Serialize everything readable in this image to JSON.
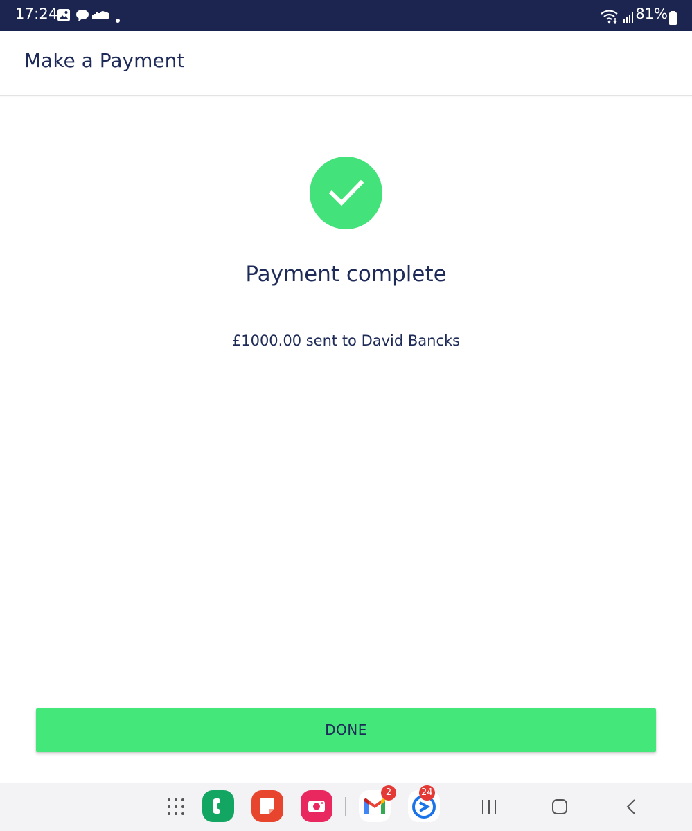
{
  "status_bar": {
    "time": "17:24",
    "battery_percent": "81%",
    "notification_icons": [
      "gallery-icon",
      "chat-bubble-icon",
      "soundcloud-icon",
      "dot-icon"
    ],
    "system_icons": [
      "wifi-icon",
      "signal-icon",
      "battery-icon"
    ]
  },
  "app_bar": {
    "title": "Make a Payment"
  },
  "result": {
    "icon": "checkmark-icon",
    "title": "Payment complete",
    "message": "£1000.00 sent to David Bancks"
  },
  "actions": {
    "done_label": "DONE"
  },
  "nav_bar": {
    "apps": [
      {
        "name": "app-drawer-icon"
      },
      {
        "name": "phone-app-icon"
      },
      {
        "name": "notes-app-icon"
      },
      {
        "name": "camera-app-icon"
      },
      {
        "name": "gmail-app-icon",
        "badge": "2"
      },
      {
        "name": "outlook-app-icon",
        "badge": "24"
      }
    ],
    "buttons": [
      "recents-button",
      "home-button",
      "back-button"
    ]
  },
  "colors": {
    "status_bar": "#1b2550",
    "text_primary": "#1e2b58",
    "accent_green": "#44e27a",
    "badge_red": "#e53935"
  }
}
